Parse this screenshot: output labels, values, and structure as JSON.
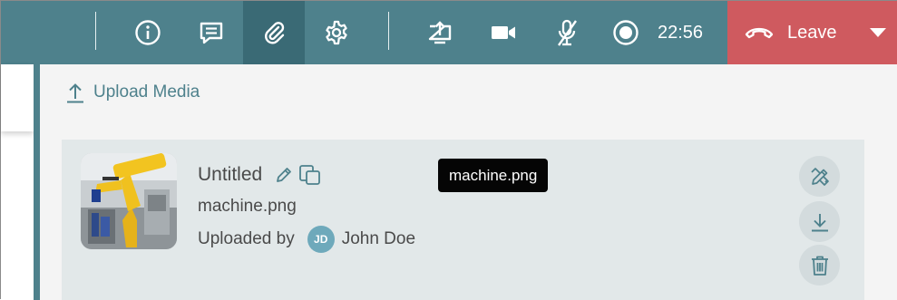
{
  "toolbar": {
    "icons": {
      "info": "info-icon",
      "chat": "chat-icon",
      "attachment": "paperclip-icon",
      "settings": "gear-icon",
      "share": "share-screen-icon",
      "camera": "camera-icon",
      "mic": "mic-muted-icon",
      "record": "record-icon"
    },
    "clock": "22:56",
    "leave_label": "Leave"
  },
  "panel": {
    "upload_label": "Upload Media",
    "item": {
      "title": "Untitled",
      "filename": "machine.png",
      "uploaded_by_label": "Uploaded by",
      "user_initials": "JD",
      "user_name": "John Doe",
      "tooltip": "machine.png"
    }
  },
  "colors": {
    "toolbar": "#4e818c",
    "toolbar_active": "#3a6a75",
    "leave": "#cf5a5f",
    "accent": "#4e818c",
    "card": "#e2e8e9",
    "avatar": "#6ea9bb"
  }
}
